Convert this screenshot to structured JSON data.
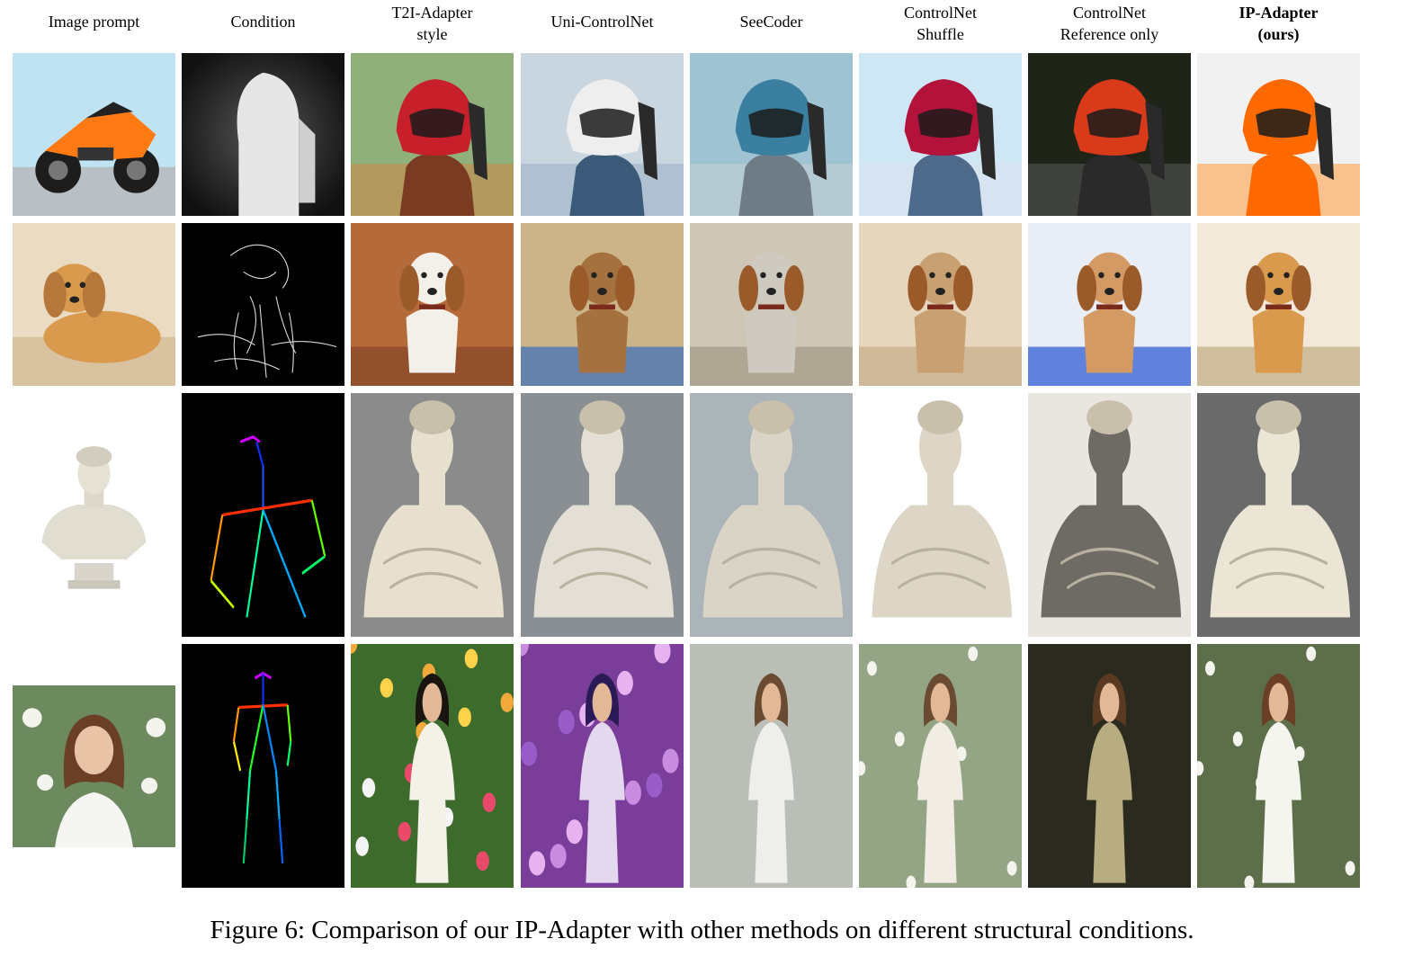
{
  "figure": {
    "columns": [
      {
        "lines": [
          "Image prompt"
        ],
        "bold": false
      },
      {
        "lines": [
          "Condition"
        ],
        "bold": false
      },
      {
        "lines": [
          "T2I-Adapter",
          "style"
        ],
        "bold": false
      },
      {
        "lines": [
          "Uni-ControlNet"
        ],
        "bold": false
      },
      {
        "lines": [
          "SeeCoder"
        ],
        "bold": false
      },
      {
        "lines": [
          "ControlNet",
          "Shuffle"
        ],
        "bold": false
      },
      {
        "lines": [
          "ControlNet",
          "Reference only"
        ],
        "bold": false
      },
      {
        "lines": [
          "IP-Adapter",
          "(ours)"
        ],
        "bold": true
      }
    ],
    "rows": [
      {
        "subject": "motorcycle-helmet"
      },
      {
        "subject": "dog-watercolor"
      },
      {
        "subject": "bust-statue"
      },
      {
        "subject": "woman-in-garden"
      }
    ],
    "caption": "Figure 6: Comparison of our IP-Adapter with other methods on different structural conditions."
  }
}
